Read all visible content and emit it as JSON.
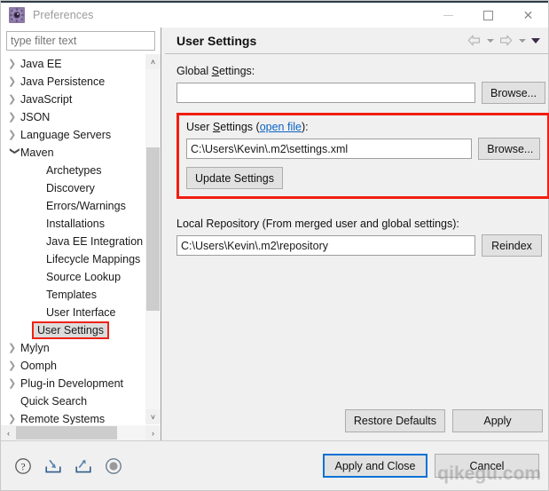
{
  "window": {
    "title": "Preferences",
    "icon": "preferences-gear-icon",
    "controls": {
      "minimize": "minimize-icon",
      "maximize": "maximize-icon",
      "close": "close-icon"
    }
  },
  "sidebar": {
    "filter": {
      "value": "",
      "placeholder": "type filter text"
    },
    "items": [
      {
        "label": "Java EE",
        "level": 0,
        "twisty": "collapsed",
        "selected": false
      },
      {
        "label": "Java Persistence",
        "level": 0,
        "twisty": "collapsed",
        "selected": false
      },
      {
        "label": "JavaScript",
        "level": 0,
        "twisty": "collapsed",
        "selected": false
      },
      {
        "label": "JSON",
        "level": 0,
        "twisty": "collapsed",
        "selected": false
      },
      {
        "label": "Language Servers",
        "level": 0,
        "twisty": "collapsed",
        "selected": false
      },
      {
        "label": "Maven",
        "level": 0,
        "twisty": "expanded",
        "selected": false
      },
      {
        "label": "Archetypes",
        "level": 1,
        "twisty": "none",
        "selected": false
      },
      {
        "label": "Discovery",
        "level": 1,
        "twisty": "none",
        "selected": false
      },
      {
        "label": "Errors/Warnings",
        "level": 1,
        "twisty": "none",
        "selected": false
      },
      {
        "label": "Installations",
        "level": 1,
        "twisty": "none",
        "selected": false
      },
      {
        "label": "Java EE Integration",
        "level": 1,
        "twisty": "none",
        "selected": false
      },
      {
        "label": "Lifecycle Mappings",
        "level": 1,
        "twisty": "none",
        "selected": false
      },
      {
        "label": "Source Lookup",
        "level": 1,
        "twisty": "none",
        "selected": false
      },
      {
        "label": "Templates",
        "level": 1,
        "twisty": "none",
        "selected": false
      },
      {
        "label": "User Interface",
        "level": 1,
        "twisty": "none",
        "selected": false
      },
      {
        "label": "User Settings",
        "level": 1,
        "twisty": "none",
        "selected": true
      },
      {
        "label": "Mylyn",
        "level": 0,
        "twisty": "collapsed",
        "selected": false
      },
      {
        "label": "Oomph",
        "level": 0,
        "twisty": "collapsed",
        "selected": false
      },
      {
        "label": "Plug-in Development",
        "level": 0,
        "twisty": "collapsed",
        "selected": false
      },
      {
        "label": "Quick Search",
        "level": 0,
        "twisty": "none",
        "selected": false
      },
      {
        "label": "Remote Systems",
        "level": 0,
        "twisty": "collapsed",
        "selected": false
      }
    ],
    "scroll_up_glyph": "˄",
    "scroll_down_glyph": "˅",
    "scroll_left_glyph": "‹",
    "scroll_right_glyph": "›"
  },
  "page": {
    "title": "User Settings",
    "nav": {
      "back": "back-arrow-icon",
      "back_menu": "back-dropdown-icon",
      "forward": "forward-arrow-icon",
      "forward_menu": "forward-dropdown-icon",
      "view_menu": "view-menu-icon"
    },
    "global_settings": {
      "label_pre": "Global ",
      "label_mnemonic": "S",
      "label_post": "ettings:",
      "value": "",
      "placeholder": "",
      "browse_label": "Browse..."
    },
    "user_settings": {
      "label_pre": "User ",
      "label_mnemonic": "S",
      "label_mid": "ettings (",
      "link_label": "open file",
      "label_post": "):",
      "value": "C:\\Users\\Kevin\\.m2\\settings.xml",
      "browse_label": "Browse...",
      "update_label": "Update Settings",
      "highlight_color": "#f01e10"
    },
    "local_repository": {
      "label": "Local Repository (From merged user and global settings):",
      "value": "C:\\Users\\Kevin\\.m2\\repository",
      "reindex_label": "Reindex"
    },
    "restore_defaults_label": "Restore Defaults",
    "apply_label": "Apply"
  },
  "footer": {
    "icons": [
      {
        "name": "help-icon"
      },
      {
        "name": "import-icon"
      },
      {
        "name": "export-icon"
      },
      {
        "name": "record-icon"
      }
    ],
    "apply_and_close_label": "Apply and Close",
    "cancel_label": "Cancel",
    "default_button_accent": "#0a72d4"
  },
  "watermark": "qikegu.com"
}
